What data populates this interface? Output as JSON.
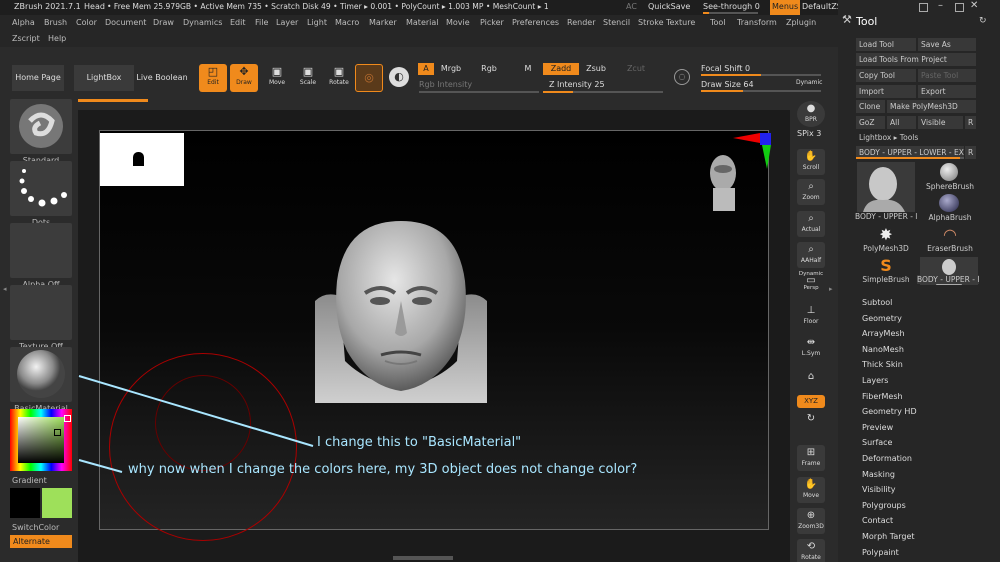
{
  "titlebar": {
    "app": "ZBrush 2021.7.1",
    "doc": "Head",
    "mem": "• Free Mem 25.979GB • Active Mem 735 • Scratch Disk 49 • Timer ▸ 0.001 • PolyCount ▸ 1.003 MP • MeshCount ▸ 1",
    "ac": "AC",
    "quicksave": "QuickSave",
    "seethrough": "See-through 0",
    "menus": "Menus",
    "script": "DefaultZScript"
  },
  "menu": [
    "Alpha",
    "Brush",
    "Color",
    "Document",
    "Draw",
    "Dynamics",
    "Edit",
    "File",
    "Layer",
    "Light",
    "Macro",
    "Marker",
    "Material",
    "Movie",
    "Picker",
    "Preferences",
    "Render",
    "Stencil",
    "Stroke",
    "Texture",
    "Tool",
    "Transform",
    "Zplugin"
  ],
  "menu2": [
    "Zscript",
    "Help"
  ],
  "shelf": {
    "home": "Home Page",
    "lightbox": "LightBox",
    "boolean": "Live Boolean",
    "edit": "Edit",
    "draw": "Draw",
    "move": "Move",
    "scale": "Scale",
    "rotate": "Rotate",
    "a": "A",
    "mrgb": "Mrgb",
    "rgb": "Rgb",
    "m": "M",
    "rgbint": "Rgb Intensity",
    "zadd": "Zadd",
    "zsub": "Zsub",
    "zcut": "Zcut",
    "zint": "Z Intensity 25",
    "focal": "Focal Shift 0",
    "drawsize": "Draw Size 64",
    "dynamic": "Dynamic",
    "focal_level": 0.5,
    "drawsize_level": 0.35,
    "zint_level": 0.25
  },
  "left": {
    "standard": "Standard",
    "dots": "Dots",
    "alpha": "Alpha Off",
    "texture": "Texture Off",
    "material": "BasicMaterial",
    "gradient": "Gradient",
    "switch": "SwitchColor",
    "alternate": "Alternate",
    "main_color": "#000000",
    "secondary_color": "#9ee05a"
  },
  "rightshelf": {
    "bpr": "BPR",
    "spix": "SPix 3",
    "scroll": "Scroll",
    "zoom": "Zoom",
    "actual": "Actual",
    "aahalf": "AAHalf",
    "dynamic": "Dynamic",
    "persp": "Persp",
    "floor": "Floor",
    "lsym": "L.Sym",
    "xyz": "XYZ",
    "frame": "Frame",
    "move": "Move",
    "zoom3d": "Zoom3D",
    "rotate": "Rotate"
  },
  "tray": {
    "title": "Tool",
    "buttons": [
      "Load Tool",
      "Save As",
      "Load Tools From Project",
      "Copy Tool",
      "Paste Tool",
      "Import",
      "Export",
      "Clone",
      "Make PolyMesh3D",
      "GoZ",
      "All",
      "Visible",
      "R",
      "Lightbox ▸ Tools",
      "BODY - UPPER - LOWER - EXP",
      "R"
    ],
    "thumbs": [
      "BODY - UPPER - l",
      "SphereBrush",
      "AlphaBrush",
      "PolyMesh3D",
      "EraserBrush",
      "SimpleBrush",
      "BODY - UPPER - I"
    ],
    "submenus": [
      "Subtool",
      "Geometry",
      "ArrayMesh",
      "NanoMesh",
      "Thick Skin",
      "Layers",
      "FiberMesh",
      "Geometry HD",
      "Preview",
      "Surface",
      "Deformation",
      "Masking",
      "Visibility",
      "Polygroups",
      "Contact",
      "Morph Target",
      "Polypaint"
    ]
  },
  "annotations": {
    "a1": "I change this to \"BasicMaterial\"",
    "a2": "why now when I change the colors here,  my 3D object does not change color?"
  },
  "colors": {
    "accent": "#f08a1c",
    "annotation": "#a9e6ff"
  }
}
